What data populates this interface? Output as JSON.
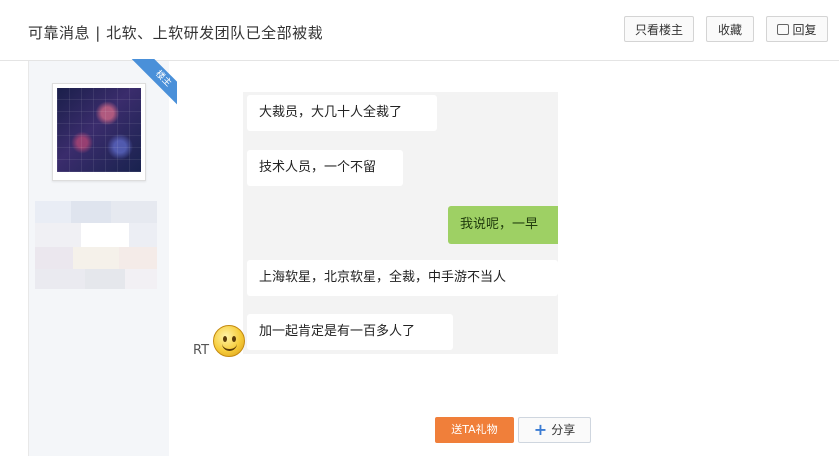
{
  "header": {
    "title": "可靠消息 | 北软、上软研发团队已全部被裁",
    "buttons": [
      {
        "label": "只看楼主"
      },
      {
        "label": "收藏"
      },
      {
        "label": "回复",
        "icon": "comment-icon"
      }
    ]
  },
  "post": {
    "author_badge": "楼主",
    "messages": [
      {
        "text": "大裁员，大几十人全裁了",
        "side": "left"
      },
      {
        "text": "技术人员，一个不留",
        "side": "left"
      },
      {
        "text": "我说呢，一早",
        "side": "right"
      },
      {
        "text": "上海软星，北京软星，全裁，中手游不当人",
        "side": "left"
      },
      {
        "text": "加一起肯定是有一百多人了",
        "side": "left"
      }
    ],
    "rt_label": "RT",
    "emoji": "smile-emoji-icon"
  },
  "actions": {
    "gift_label": "送TA礼物",
    "share_label": "分享"
  },
  "colors": {
    "gift_button": "#f07f3a",
    "green_bubble": "#9ed064",
    "badge": "#4a90d9"
  }
}
